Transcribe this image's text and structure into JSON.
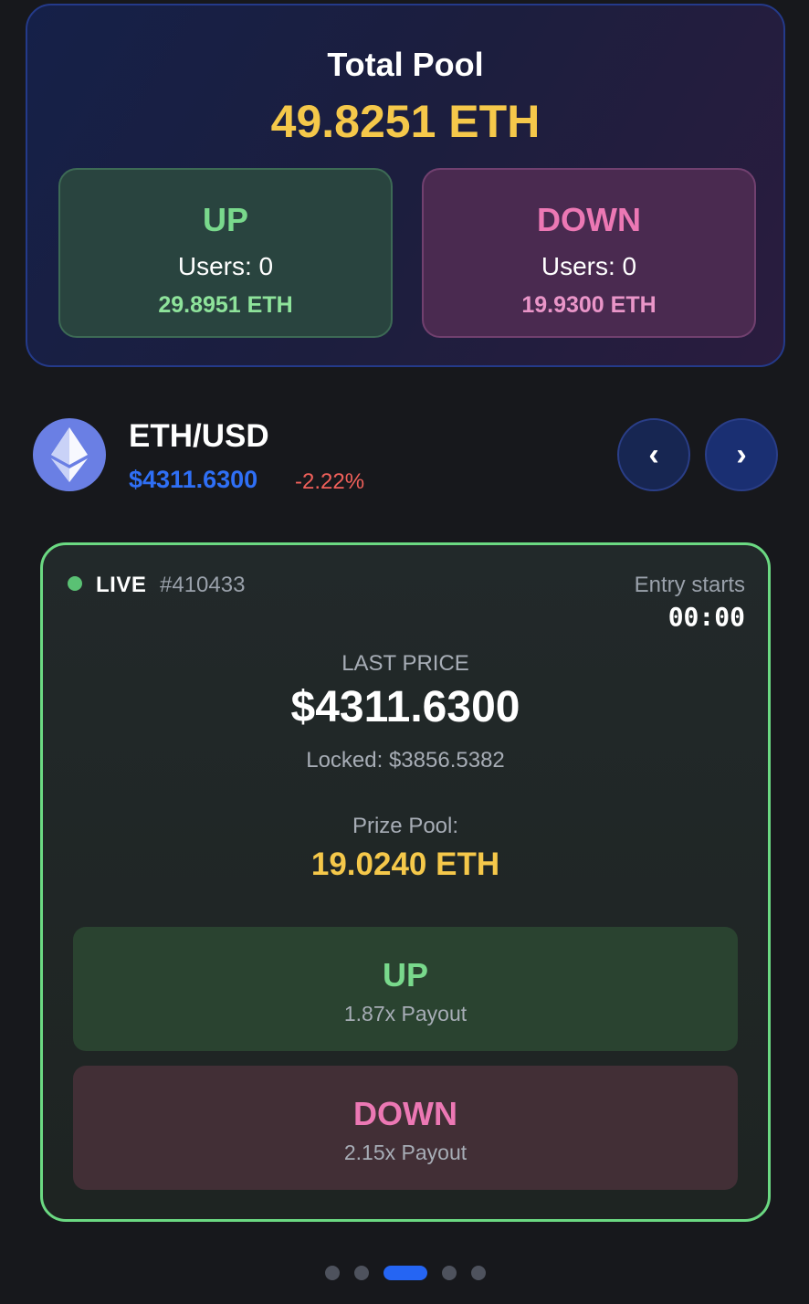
{
  "pool": {
    "title": "Total Pool",
    "total": "49.8251 ETH",
    "up": {
      "label": "UP",
      "users": "Users: 0",
      "amount": "29.8951 ETH"
    },
    "down": {
      "label": "DOWN",
      "users": "Users: 0",
      "amount": "19.9300 ETH"
    }
  },
  "asset": {
    "icon": "ethereum-icon",
    "pair": "ETH/USD",
    "price": "$4311.6300",
    "change": "-2.22%",
    "prev_label": "‹",
    "next_label": "›"
  },
  "round": {
    "status": "LIVE",
    "id": "#410433",
    "entry_label": "Entry starts",
    "entry_timer": "00:00",
    "last_price_label": "LAST PRICE",
    "last_price": "$4311.6300",
    "locked": "Locked: $3856.5382",
    "prize_label": "Prize Pool:",
    "prize_value": "19.0240 ETH",
    "up_button": {
      "label": "UP",
      "payout": "1.87x Payout"
    },
    "down_button": {
      "label": "DOWN",
      "payout": "2.15x Payout"
    }
  },
  "pagination": {
    "total": 5,
    "active_index": 2
  },
  "colors": {
    "accent_gold": "#f5c84a",
    "up_green": "#79d98c",
    "down_pink": "#ec78b4",
    "price_blue": "#2f6ff5",
    "negative_red": "#f0605a",
    "live_border": "#6bd982"
  }
}
